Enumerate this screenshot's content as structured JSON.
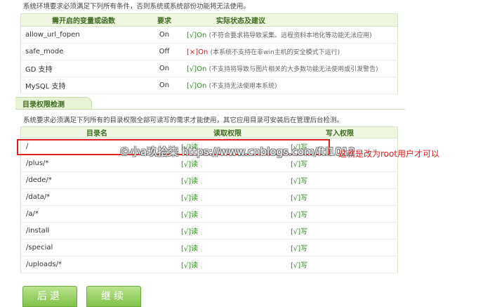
{
  "top_note": "系统环境要求必须满足下列所有条件，否则系统或系统部份功能将无法使用。",
  "env_table": {
    "headers": [
      "需开启的变量或函数",
      "要求",
      "实际状态及建议"
    ],
    "rows": [
      {
        "name": "allow_url_fopen",
        "req": "On",
        "mark": "[√]",
        "state": "On",
        "hint": "(不符合要求将导致采集、远程资料本地化等功能无法应用)"
      },
      {
        "name": "safe_mode",
        "req": "Off",
        "mark": "[×]",
        "state": "On",
        "hint": "(本系统不支持在非win主机的安全模式下运行)"
      },
      {
        "name": "GD 支持",
        "req": "On",
        "mark": "[√]",
        "state": "On",
        "hint": "(不支持将导致与图片相关的大多数功能无法使用或引发警告)"
      },
      {
        "name": "MySQL 支持",
        "req": "On",
        "mark": "[√]",
        "state": "On",
        "hint": "(不支持无法使用本系统)"
      }
    ]
  },
  "dir_section": {
    "title": "目录权限检测",
    "desc": "系统要求必须满足下列所有的目录权限全部可读写的需求才能使用，其它应用目录可安装后在管理后台检测。",
    "headers": [
      "目录名",
      "读取权限",
      "写入权限"
    ],
    "rows": [
      {
        "dir": "/",
        "read": "[√]读",
        "write": "[√]写"
      },
      {
        "dir": "/plus/*",
        "read": "[√]读",
        "write": "[√]写"
      },
      {
        "dir": "/dede/*",
        "read": "[√]读",
        "write": "[√]写"
      },
      {
        "dir": "/data/*",
        "read": "[√]读",
        "write": "[√]写"
      },
      {
        "dir": "/a/*",
        "read": "[√]读",
        "write": "[√]写"
      },
      {
        "dir": "/install",
        "read": "[√]读",
        "write": "[√]写"
      },
      {
        "dir": "/special",
        "read": "[√]读",
        "write": "[√]写"
      },
      {
        "dir": "/uploads/*",
        "read": "[√]读",
        "write": "[√]写"
      }
    ]
  },
  "annotation": "这就是改为root用户才可以",
  "watermark": "©小a玖拾柒 https://www.cnblogs.com/ftl1012",
  "buttons": {
    "prev": "后退",
    "next": "继续"
  },
  "colors": {
    "ok": "#2e8b1a",
    "bad": "#d42020",
    "header_bg": "#eef6e2",
    "button": "#8fcc5a",
    "annotation": "#e02020"
  }
}
